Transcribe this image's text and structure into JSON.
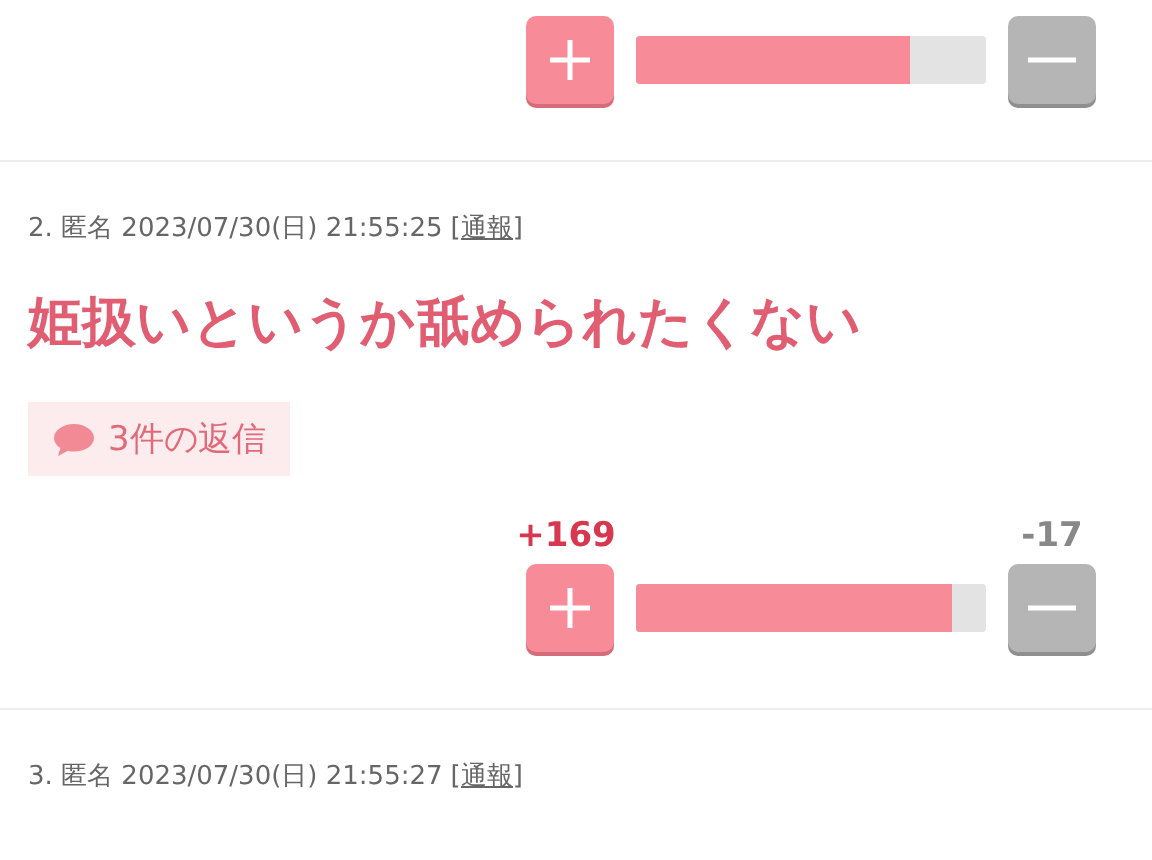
{
  "posts": [
    {
      "votes": {
        "level": 0.78
      }
    },
    {
      "meta": "2. 匿名 2023/07/30(日) 21:55:25",
      "report": "[通報]",
      "title": "姫扱いというか舐められたくない",
      "replies": "3件の返信",
      "votes": {
        "plus": "+169",
        "minus": "-17",
        "level": 0.9
      }
    },
    {
      "meta": "3. 匿名 2023/07/30(日) 21:55:27",
      "report": "[通報]"
    }
  ]
}
